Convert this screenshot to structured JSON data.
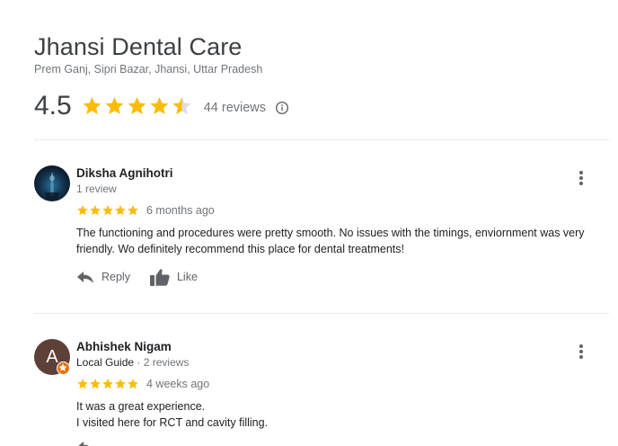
{
  "place": {
    "name": "Jhansi Dental Care",
    "address": "Prem Ganj, Sipri Bazar, Jhansi, Uttar Pradesh",
    "rating": "4.5",
    "rating_value": 4.5,
    "reviews_label": "44 reviews"
  },
  "colors": {
    "star": "#fbbc04",
    "star_empty": "#dadce0",
    "guide_badge": "#e8710a",
    "avatar_bg": "#5d4037"
  },
  "reviews": [
    {
      "name": "Diksha Agnihotri",
      "meta": "1 review",
      "stars": 5,
      "date": "6 months ago",
      "text_lines": [
        "The functioning and procedures were pretty smooth. No issues with the timings, enviornment was very",
        "friendly. Wo definitely recommend this place for dental treatments!"
      ],
      "reply_label": "Reply",
      "like_label": "Like"
    },
    {
      "name": "Abhishek Nigam",
      "avatar_letter": "A",
      "local_guide": "Local Guide",
      "meta": "2 reviews",
      "stars": 5,
      "date": "4 weeks ago",
      "text_lines": [
        "It was a great experience.",
        "I visited here for RCT and cavity filling."
      ]
    }
  ]
}
